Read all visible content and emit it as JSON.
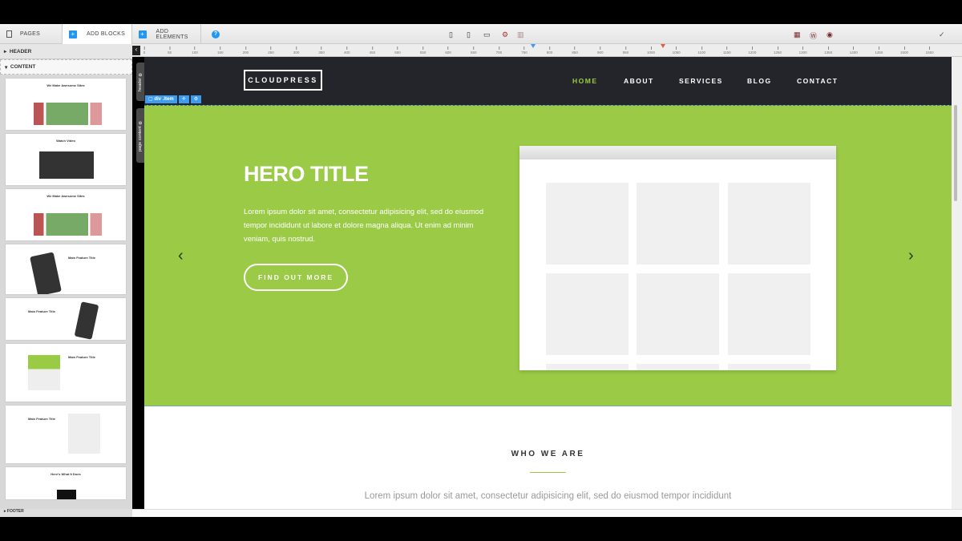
{
  "toolbar": {
    "tabs": [
      {
        "label": "PAGES",
        "icon": "pages-icon"
      },
      {
        "label": "ADD BLOCKS",
        "icon": "plus-icon"
      },
      {
        "label": "ADD ELEMENTS",
        "icon": "plus-icon"
      }
    ],
    "help_icon": "?",
    "device_icons": [
      "mobile-icon",
      "tablet-icon",
      "desktop-icon",
      "gear-icon",
      "columns-icon"
    ],
    "right_icons": [
      "grid-icon",
      "wordpress-icon",
      "eye-icon",
      "check-icon"
    ]
  },
  "ruler": {
    "ticks": [
      "0",
      "50",
      "100",
      "150",
      "200",
      "250",
      "300",
      "350",
      "400",
      "450",
      "500",
      "550",
      "600",
      "650",
      "700",
      "750",
      "800",
      "850",
      "900",
      "950",
      "1000",
      "1050",
      "1100",
      "1150",
      "1200",
      "1250",
      "1300",
      "1350",
      "1400",
      "1450",
      "1500",
      "1550"
    ]
  },
  "sidebar": {
    "sections": {
      "header": "HEADER",
      "content": "CONTENT",
      "footer": "FOOTER"
    },
    "thumbnails": [
      "We Make Awesome Sites",
      "Watch Video",
      "We Make Awesome Sites",
      "Main Feature Title",
      "Main Feature Title",
      "Main Feature Title",
      "Main Feature Title",
      "Here's What It Does"
    ]
  },
  "canvas": {
    "side_tabs": {
      "header": "header",
      "content": "page content"
    },
    "selection": {
      "label": "div .item",
      "move": "✛",
      "settings": "⚙"
    },
    "logo": "CLOUDPRESS",
    "nav": [
      {
        "label": "HOME",
        "active": true
      },
      {
        "label": "ABOUT"
      },
      {
        "label": "SERVICES"
      },
      {
        "label": "BLOG"
      },
      {
        "label": "CONTACT"
      }
    ],
    "hero": {
      "title": "HERO TITLE",
      "text": "Lorem ipsum dolor sit amet, consectetur adipisicing elit, sed do eiusmod tempor incididunt ut labore et dolore magna aliqua. Ut enim ad minim veniam, quis nostrud.",
      "button": "FIND OUT MORE",
      "prev": "‹",
      "next": "›"
    },
    "who": {
      "title": "WHO WE ARE",
      "text": "Lorem ipsum dolor sit amet, consectetur adipisicing elit, sed do eiusmod tempor incididunt"
    }
  },
  "colors": {
    "accent": "#9aca46",
    "header_bg": "#23252b",
    "selection": "#3b9cf0"
  }
}
